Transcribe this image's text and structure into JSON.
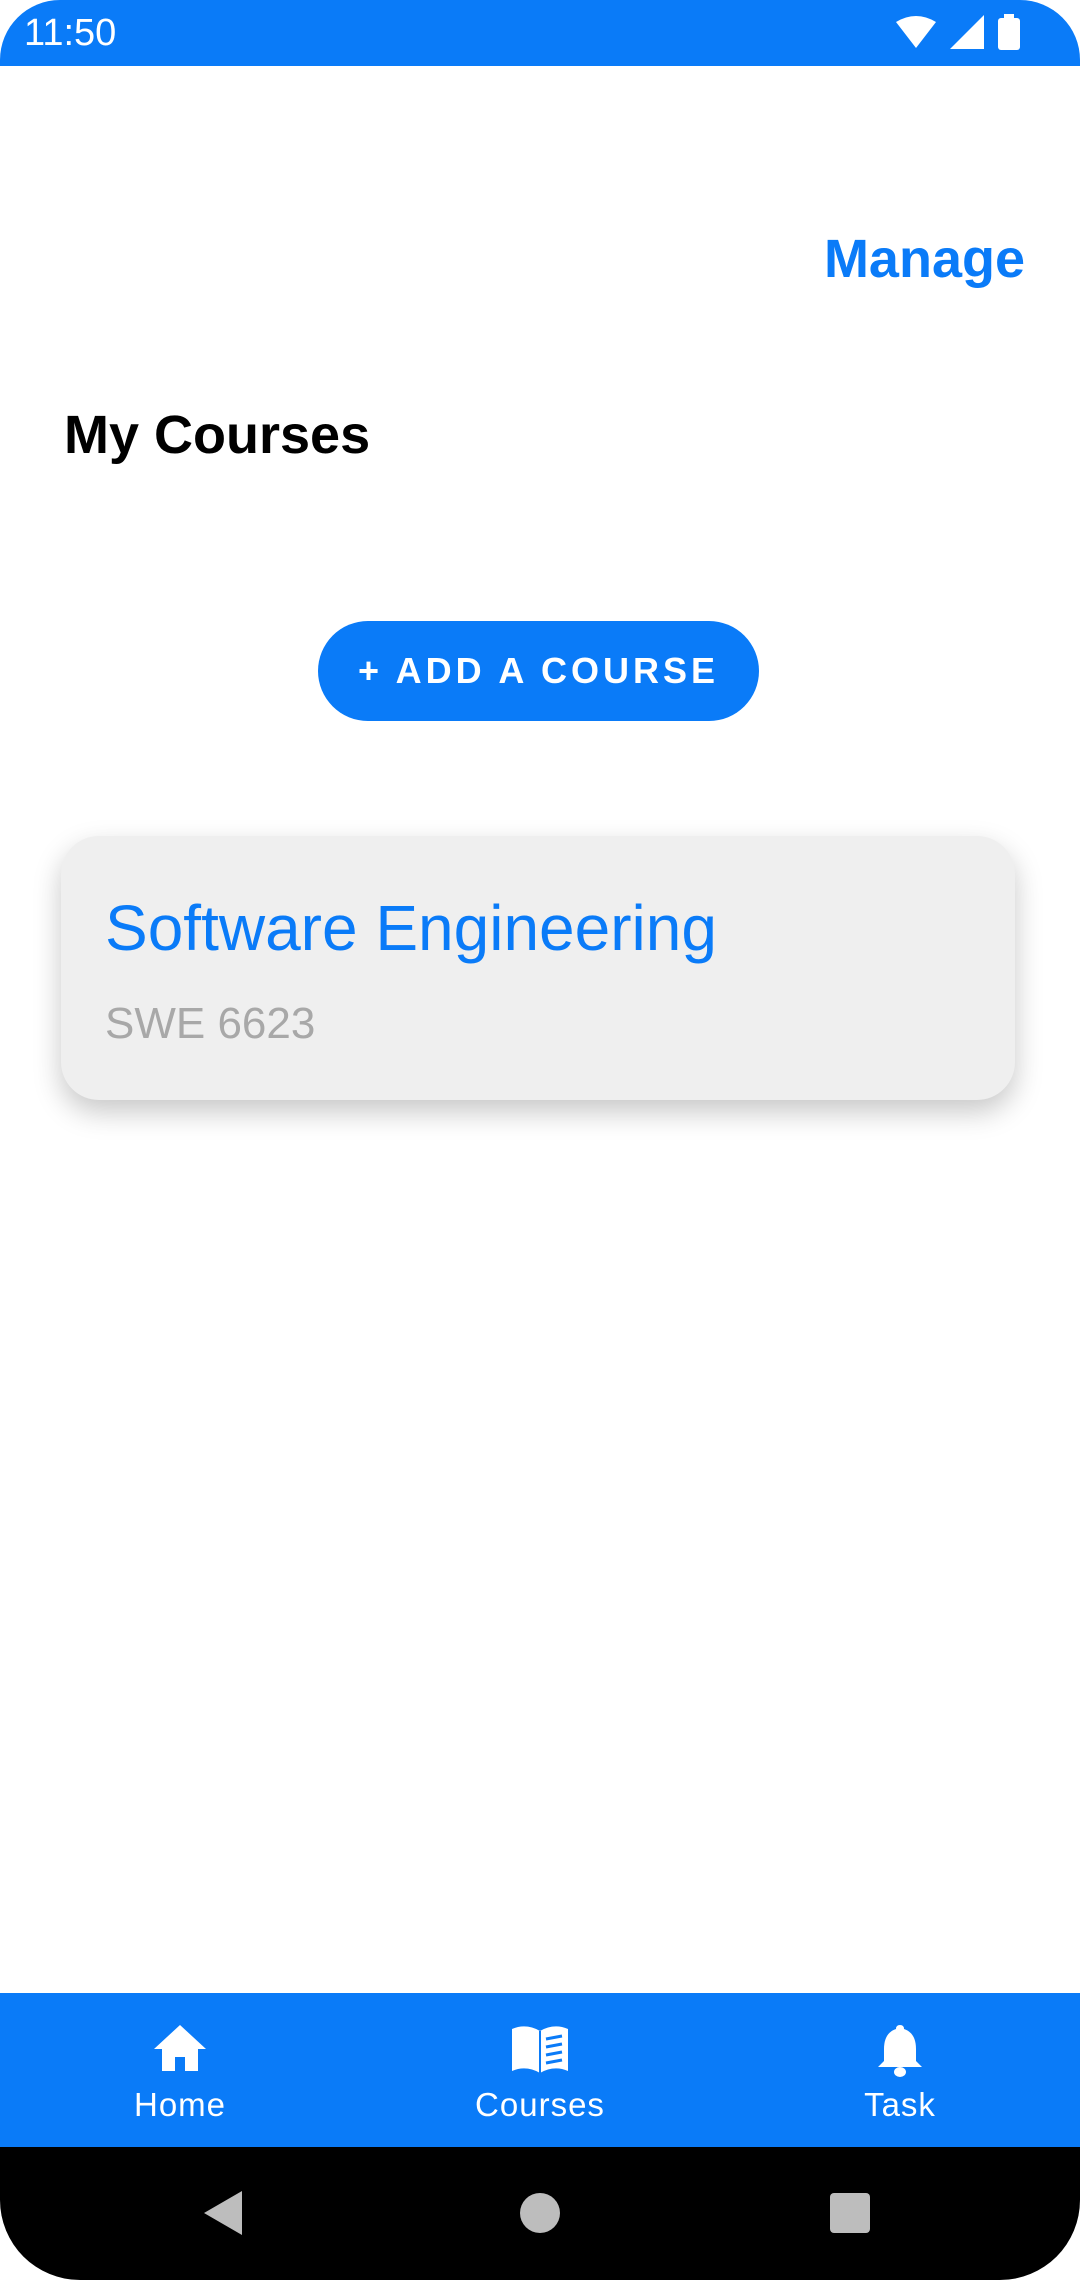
{
  "status_bar": {
    "time": "11:50",
    "icons": [
      "wifi-icon",
      "signal-icon",
      "battery-icon"
    ]
  },
  "header": {
    "manage_label": "Manage",
    "title": "My Courses"
  },
  "actions": {
    "add_course_label": "+ ADD A COURSE"
  },
  "courses": [
    {
      "title": "Software Engineering",
      "code": "SWE 6623"
    }
  ],
  "bottom_nav": {
    "items": [
      {
        "label": "Home",
        "icon": "home-icon"
      },
      {
        "label": "Courses",
        "icon": "book-icon"
      },
      {
        "label": "Task",
        "icon": "bell-icon"
      }
    ]
  },
  "system_nav": {
    "buttons": [
      "back-icon",
      "home-circle-icon",
      "recents-icon"
    ]
  },
  "colors": {
    "accent": "#0a7bf8",
    "card_background": "#efefef",
    "secondary_text": "#a8a8a8"
  }
}
